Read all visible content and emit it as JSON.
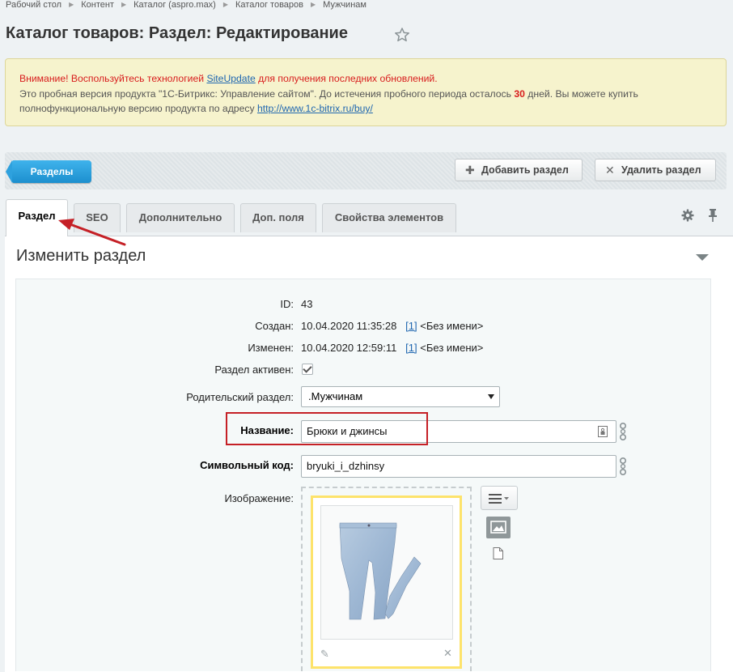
{
  "breadcrumbs": [
    "Рабочий стол",
    "Контент",
    "Каталог (aspro.max)",
    "Каталог товаров",
    "Мужчинам"
  ],
  "page": {
    "title": "Каталог товаров: Раздел: Редактирование",
    "favorite_icon": "star-icon"
  },
  "notice": {
    "line1_before": "Внимание! Воспользуйтесь технологией ",
    "line1_link": "SiteUpdate",
    "line1_after": " для получения последних обновлений.",
    "line2_before": "Это пробная версия продукта \"1С-Битрикс: Управление сайтом\". До истечения пробного периода осталось ",
    "days": "30",
    "line2_after": " дней. Вы можете купить",
    "line3_before": "полнофункциональную версию продукта по адресу ",
    "line3_link": "http://www.1c-bitrix.ru/buy/"
  },
  "toolbar": {
    "sections_button": "Разделы",
    "add_button": "Добавить раздел",
    "delete_button": "Удалить раздел"
  },
  "tabs": [
    {
      "label": "Раздел",
      "active": true
    },
    {
      "label": "SEO",
      "active": false
    },
    {
      "label": "Дополнительно",
      "active": false
    },
    {
      "label": "Доп. поля",
      "active": false
    },
    {
      "label": "Свойства элементов",
      "active": false
    }
  ],
  "panel": {
    "title": "Изменить раздел"
  },
  "form": {
    "id_label": "ID:",
    "id_value": "43",
    "created_label": "Создан:",
    "created_value": "10.04.2020 11:35:28",
    "created_user_link": "[1]",
    "created_user_name": " <Без имени>",
    "modified_label": "Изменен:",
    "modified_value": "10.04.2020 12:59:11",
    "modified_user_link": "[1]",
    "modified_user_name": " <Без имени>",
    "active_label": "Раздел активен:",
    "active_checked": true,
    "parent_label": "Родительский раздел:",
    "parent_value": ".Мужчинам",
    "name_label": "Название:",
    "name_value": "Брюки и джинсы",
    "code_label": "Символьный код:",
    "code_value": "bryuki_i_dzhinsy",
    "image_label": "Изображение:"
  },
  "colors": {
    "accent": "#2ea1de",
    "annotation": "#c52026",
    "image_frame": "#fde36b"
  }
}
